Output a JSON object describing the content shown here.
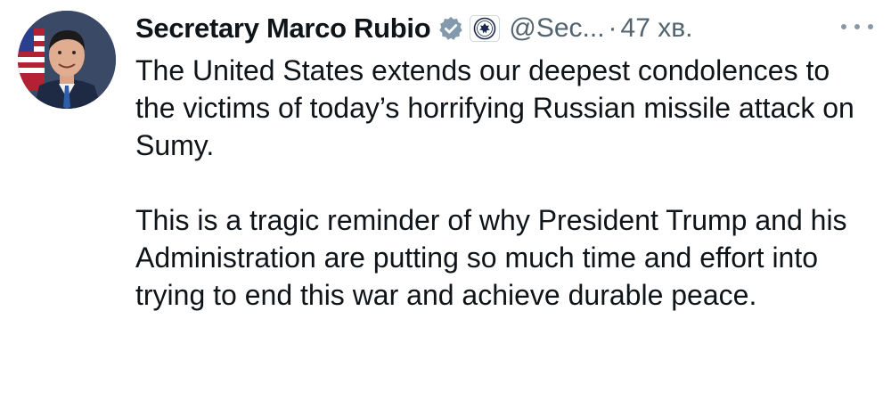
{
  "author": {
    "display_name": "Secretary Marco Rubio",
    "handle": "@Sec...",
    "separator": "·",
    "timestamp": "47 хв."
  },
  "badges": {
    "verified_icon": "verified-check-icon",
    "affiliate_icon": "state-department-seal-icon",
    "verified_color": "#829aab"
  },
  "tweet": {
    "paragraphs": [
      "The United States extends our deepest condolences to the victims of today’s horrifying Russian missile attack on Sumy.",
      "This is a tragic reminder of why President Trump and his Administration are putting so much time and effort into trying to end this war and achieve durable peace."
    ]
  },
  "colors": {
    "text": "#0f1419",
    "secondary_text": "#536471",
    "more_dots": "#8b98a5"
  }
}
